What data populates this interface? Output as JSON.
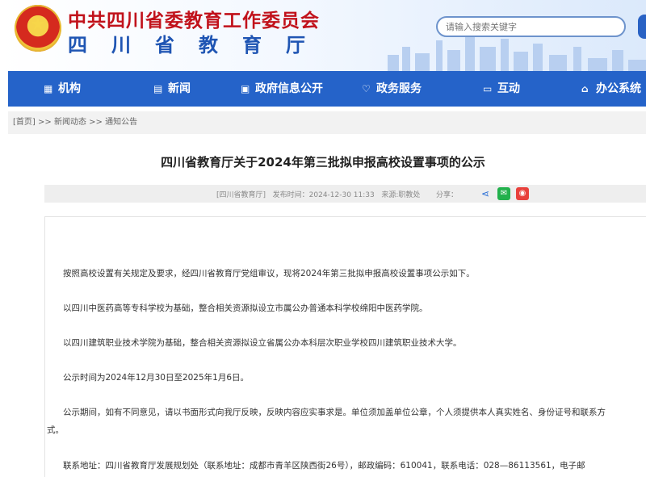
{
  "header": {
    "title_line1": "中共四川省委教育工作委员会",
    "title_line2": "四川省教育厅",
    "search_placeholder": "请输入搜索关键字",
    "brand_red": "#c1121b",
    "brand_blue": "#1f55b3"
  },
  "nav": {
    "bg_color": "#2563c9",
    "items": [
      {
        "label": "机构",
        "icon": "building-icon"
      },
      {
        "label": "新闻",
        "icon": "news-icon"
      },
      {
        "label": "政府信息公开",
        "icon": "document-icon"
      },
      {
        "label": "政务服务",
        "icon": "heart-hand-icon"
      },
      {
        "label": "互动",
        "icon": "chat-icon"
      },
      {
        "label": "办公系统",
        "icon": "office-icon"
      }
    ]
  },
  "breadcrumb": {
    "home": "[首页]",
    "sep": ">>",
    "level1": "新闻动态",
    "level2": "通知公告"
  },
  "article": {
    "title": "四川省教育厅关于2024年第三批拟申报高校设置事项的公示",
    "source_tag": "[四川省教育厅]",
    "publish_label": "发布时间：",
    "publish_time": "2024-12-30 11:33",
    "from_label": "来源:",
    "from_value": "职教处",
    "share_label": "分享：",
    "paragraphs": [
      "按照高校设置有关规定及要求，经四川省教育厅党组审议，现将2024年第三批拟申报高校设置事项公示如下。",
      "以四川中医药高等专科学校为基础，整合相关资源拟设立市属公办普通本科学校绵阳中医药学院。",
      "以四川建筑职业技术学院为基础，整合相关资源拟设立省属公办本科层次职业学校四川建筑职业技术大学。",
      "公示时间为2024年12月30日至2025年1月6日。",
      "公示期间，如有不同意见，请以书面形式向我厅反映，反映内容应实事求是。单位须加盖单位公章，个人须提供本人真实姓名、身份证号和联系方",
      "式。",
      "联系地址：四川省教育厅发展规划处（联系地址：成都市青羊区陕西街26号），邮政编码：610041，联系电话：028—86113561，电子邮"
    ]
  }
}
